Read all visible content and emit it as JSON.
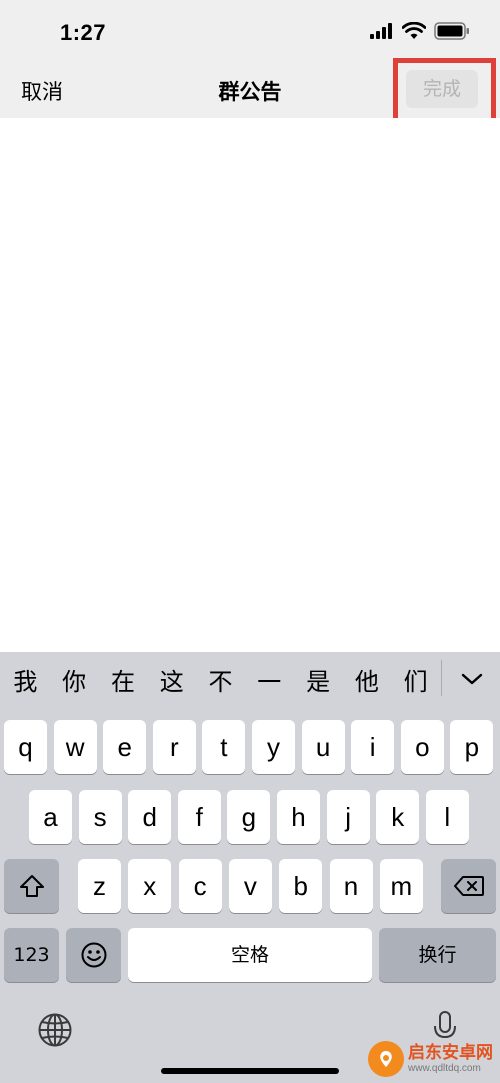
{
  "status_bar": {
    "time": "1:27"
  },
  "nav": {
    "cancel": "取消",
    "title": "群公告",
    "done": "完成"
  },
  "keyboard": {
    "candidates": [
      "我",
      "你",
      "在",
      "这",
      "不",
      "一",
      "是",
      "他",
      "们"
    ],
    "rows": [
      [
        "q",
        "w",
        "e",
        "r",
        "t",
        "y",
        "u",
        "i",
        "o",
        "p"
      ],
      [
        "a",
        "s",
        "d",
        "f",
        "g",
        "h",
        "j",
        "k",
        "l"
      ],
      [
        "z",
        "x",
        "c",
        "v",
        "b",
        "n",
        "m"
      ]
    ],
    "numbers_key": "123",
    "space_key": "空格",
    "return_key": "换行"
  },
  "watermark": {
    "name": "启东安卓网",
    "url": "www.qdltdq.com"
  },
  "colors": {
    "highlight": "#e0403a",
    "keyboard_bg": "#d1d3d9"
  }
}
